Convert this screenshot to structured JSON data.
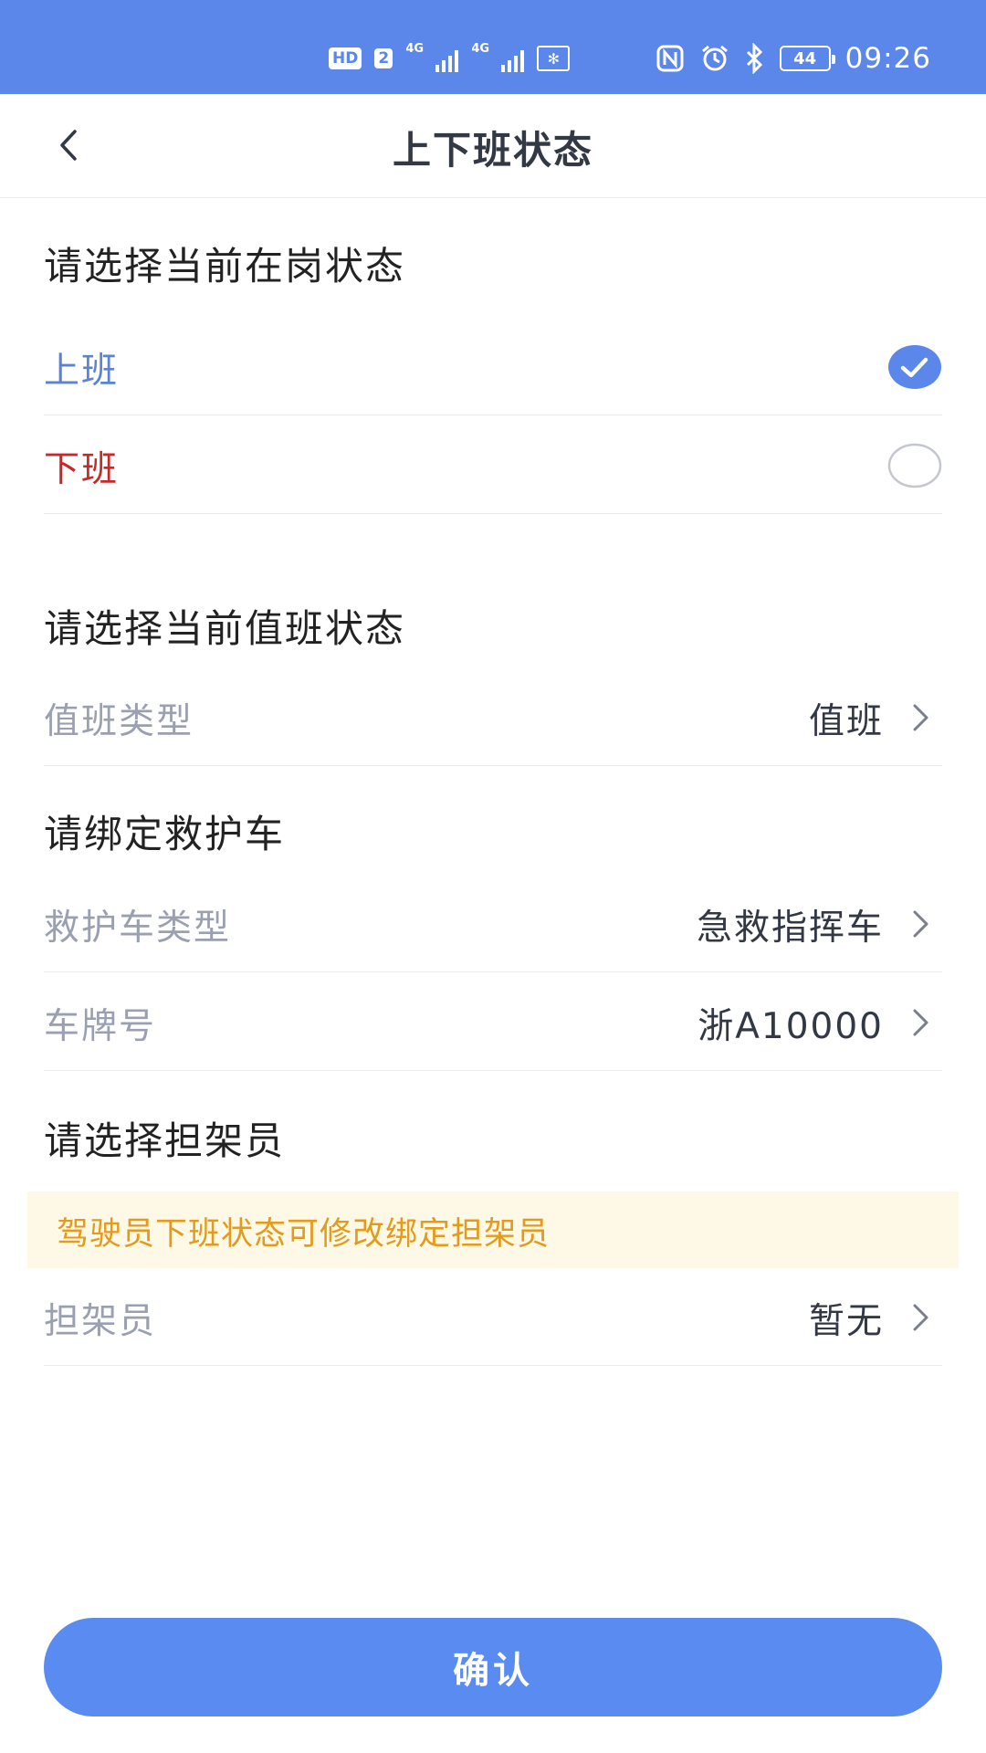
{
  "status_bar": {
    "hd": "HD",
    "sim_number": "2",
    "signal1_label": "4G",
    "signal2_label": "4G",
    "battery": "44",
    "time": "09:26"
  },
  "header": {
    "title": "上下班状态"
  },
  "sections": {
    "on_duty": {
      "title": "请选择当前在岗状态",
      "options": [
        {
          "label": "上班",
          "selected": true
        },
        {
          "label": "下班",
          "selected": false
        }
      ]
    },
    "shift": {
      "title": "请选择当前值班状态",
      "type_label": "值班类型",
      "type_value": "值班"
    },
    "ambulance": {
      "title": "请绑定救护车",
      "type_label": "救护车类型",
      "type_value": "急救指挥车",
      "plate_label": "车牌号",
      "plate_value": "浙A10000"
    },
    "stretcher": {
      "title": "请选择担架员",
      "notice": "驾驶员下班状态可修改绑定担架员",
      "label": "担架员",
      "value": "暂无"
    }
  },
  "footer": {
    "confirm_label": "确认"
  },
  "colors": {
    "status_bar": "#5b86ea",
    "on_label": "#5a82d6",
    "off_label": "#c82828",
    "muted_label": "#9aa0b0",
    "value_text": "#333845",
    "notice_bg": "#fef8e6",
    "notice_text": "#e49a1a",
    "button": "#5a8bf0"
  }
}
